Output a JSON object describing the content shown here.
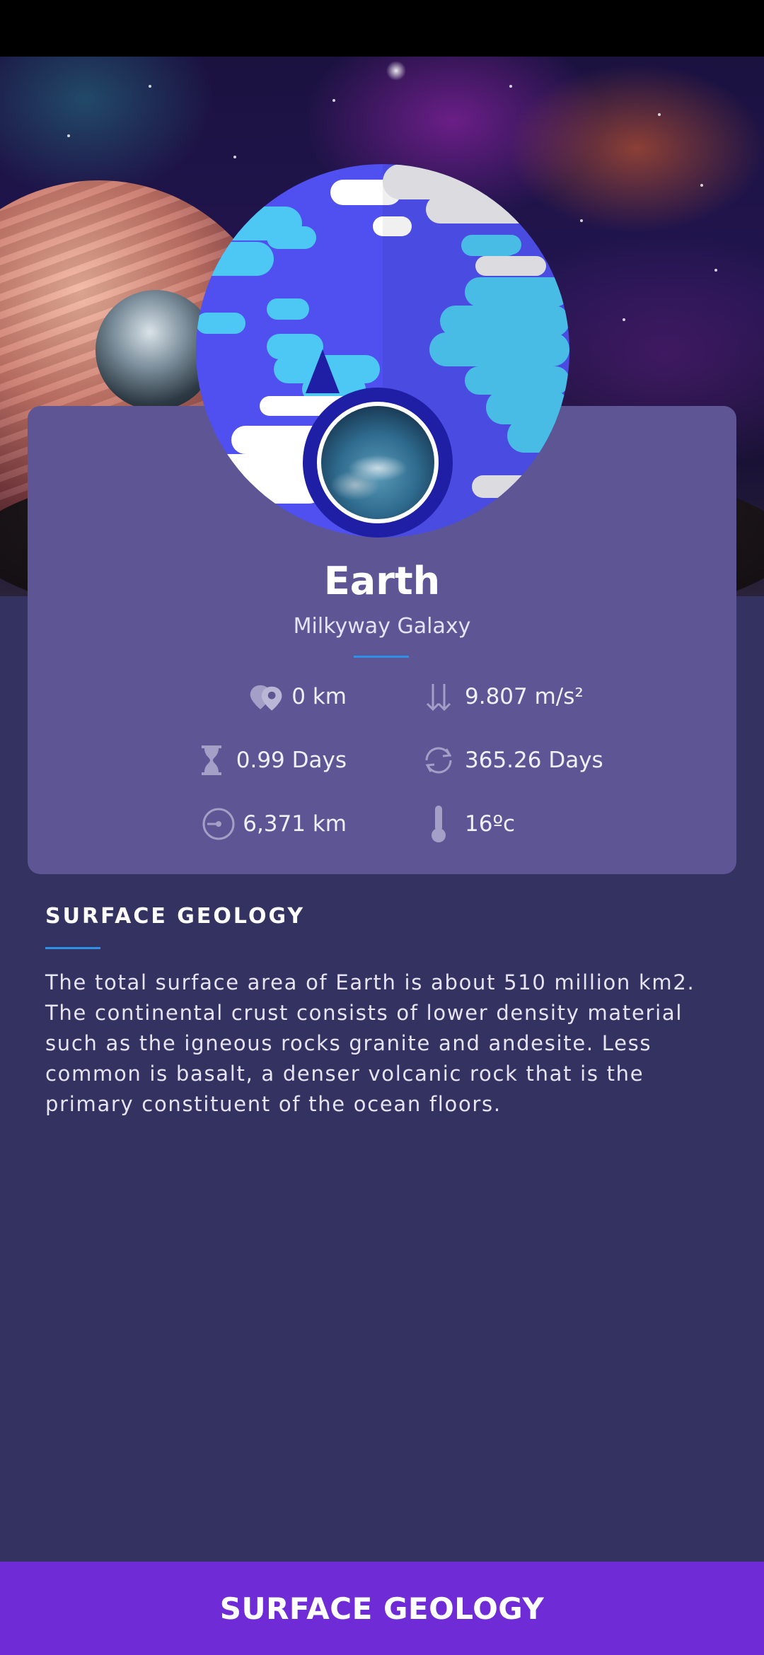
{
  "planet": {
    "name": "Earth",
    "galaxy": "Milkyway Galaxy"
  },
  "stats": {
    "distance": {
      "icon": "location-pins-icon",
      "value": "0 km"
    },
    "gravity": {
      "icon": "arrows-down-up-icon",
      "value": "9.807 m/s²"
    },
    "day_length": {
      "icon": "hourglass-icon",
      "value": "0.99 Days"
    },
    "orbital_period": {
      "icon": "orbit-arrows-icon",
      "value": "365.26 Days"
    },
    "radius": {
      "icon": "radius-circle-icon",
      "value": "6,371 km"
    },
    "temperature": {
      "icon": "thermometer-icon",
      "value": "16ºc"
    }
  },
  "section": {
    "heading": "SURFACE GEOLOGY",
    "body": "The total surface area of Earth is about 510 million km2. The continental crust consists of lower density material such as the igneous rocks granite and andesite. Less common is basalt, a denser volcanic rock that is the primary constituent of the ocean floors."
  },
  "bottom_button": {
    "label": "SURFACE GEOLOGY"
  },
  "colors": {
    "background": "#333260",
    "card": "#5e5694",
    "accent_rule": "#2f90e8",
    "button": "#6f2cd6",
    "planet_blue": "#4f50ef",
    "planet_cyan": "#4dc8f4"
  }
}
